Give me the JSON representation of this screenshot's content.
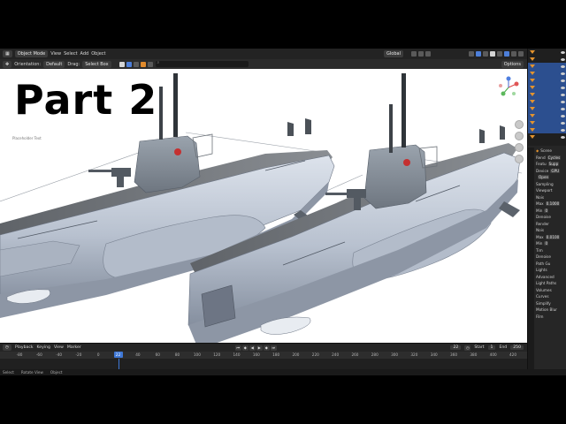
{
  "header": {
    "mode": "Object Mode",
    "menus": [
      "View",
      "Select",
      "Add",
      "Object"
    ],
    "transform_orientation": "Global",
    "orientation_label": "Orientation:",
    "orientation_value": "Default",
    "drag_label": "Drag:",
    "drag_value": "Select Box",
    "options": "Options"
  },
  "viewport": {
    "overlay_title": "Part 2",
    "placeholder_text": "Placeholder Text"
  },
  "properties": {
    "scene_label": "Scene",
    "rows": [
      {
        "label": "Rend",
        "value": "Cycles"
      },
      {
        "label": "Featu",
        "value": "Supp"
      },
      {
        "label": "Device",
        "value": "GPU"
      },
      {
        "label": "",
        "value": "Open"
      },
      {
        "label": "Sampling",
        "value": ""
      },
      {
        "label": "Viewport",
        "value": ""
      },
      {
        "label": "Nois",
        "value": ""
      },
      {
        "label": "Max",
        "value": "0.1000"
      },
      {
        "label": "Min",
        "value": "0"
      },
      {
        "label": "Denoise",
        "value": ""
      },
      {
        "label": "Render",
        "value": ""
      },
      {
        "label": "Nois",
        "value": ""
      },
      {
        "label": "Max",
        "value": "0.0100"
      },
      {
        "label": "Min",
        "value": "0"
      },
      {
        "label": "Tim",
        "value": ""
      },
      {
        "label": "Denoise",
        "value": ""
      },
      {
        "label": "Path Gu",
        "value": ""
      },
      {
        "label": "Lights",
        "value": ""
      },
      {
        "label": "Advanced",
        "value": ""
      },
      {
        "label": "Light Paths",
        "value": ""
      },
      {
        "label": "Volumes",
        "value": ""
      },
      {
        "label": "Curves",
        "value": ""
      },
      {
        "label": "Simplify",
        "value": ""
      },
      {
        "label": "Motion Blur",
        "value": ""
      },
      {
        "label": "Film",
        "value": ""
      }
    ]
  },
  "timeline": {
    "menus": [
      "Playback",
      "Keying",
      "View",
      "Marker"
    ],
    "current_frame": "22",
    "start_label": "Start",
    "start_value": "1",
    "end_label": "End",
    "end_value": "250",
    "ticks": [
      "-80",
      "-60",
      "-40",
      "-20",
      "0",
      "22",
      "40",
      "60",
      "80",
      "100",
      "120",
      "140",
      "160",
      "180",
      "200",
      "220",
      "240",
      "260",
      "280",
      "300",
      "320",
      "340",
      "360",
      "380",
      "400",
      "420"
    ]
  },
  "status": {
    "items": [
      "Select",
      "Rotate View",
      "Object"
    ]
  },
  "colors": {
    "accent": "#3f78d6",
    "object_orange": "#e3932e",
    "hull": "#c4ccd8",
    "deck": "#6a6e72"
  }
}
